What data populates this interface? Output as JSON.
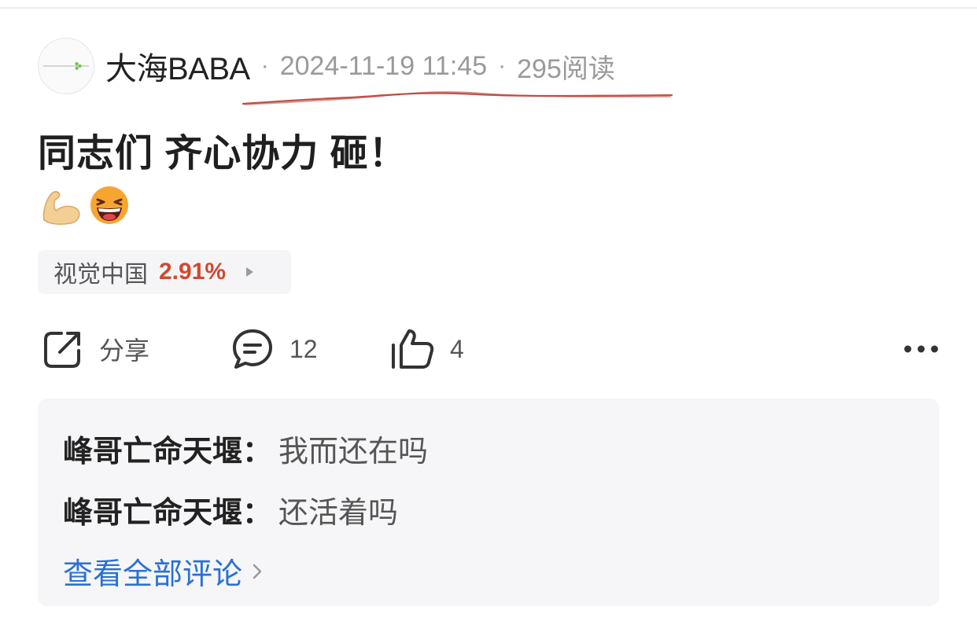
{
  "post": {
    "author": "大海BABA",
    "separator": "·",
    "timestamp": "2024-11-19 11:45",
    "reads": "295阅读",
    "title": "同志们 齐心协力 砸！"
  },
  "stock": {
    "name": "视觉中国",
    "change": "2.91%",
    "change_color": "#d1492c"
  },
  "actions": {
    "share_label": "分享",
    "comment_count": "12",
    "like_count": "4",
    "icons": [
      "share-icon",
      "comment-icon",
      "thumbs-up-icon",
      "more-icon"
    ]
  },
  "comments": [
    {
      "author": "峰哥亡命天堰",
      "colon": "：",
      "text": "我而还在吗"
    },
    {
      "author": "峰哥亡命天堰",
      "colon": "：",
      "text": "还活着吗"
    }
  ],
  "view_all_label": "查看全部评论",
  "colors": {
    "link": "#2a6fd6",
    "underline_annotation": "#b3342a"
  },
  "emojis": [
    "flexed-biceps",
    "grinning-squinting-face"
  ]
}
